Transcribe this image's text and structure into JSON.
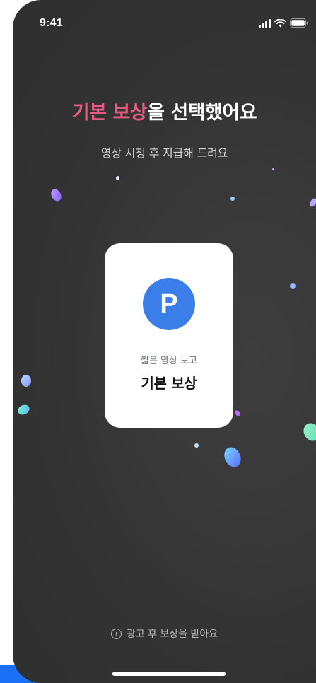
{
  "status_bar": {
    "time": "9:41"
  },
  "heading": {
    "accent": "기본 보상",
    "rest": "을 선택했어요",
    "subtitle": "영상 시청 후 지급해 드려요"
  },
  "reward_card": {
    "icon_letter": "P",
    "caption": "짧은 영상 보고",
    "title": "기본 보상"
  },
  "notice": {
    "text": "광고 후 보상을 받아요"
  },
  "colors": {
    "accent": "#e75a84",
    "point_blue": "#3b7de9",
    "background": "#333333"
  }
}
